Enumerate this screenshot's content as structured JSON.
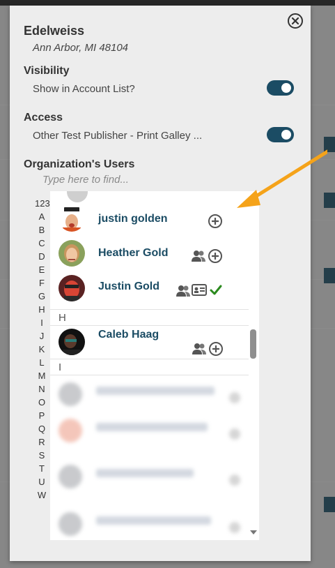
{
  "modal": {
    "org_name": "Edelweiss",
    "org_location": "Ann Arbor, MI 48104",
    "close_icon": "close-circle-icon"
  },
  "visibility": {
    "title": "Visibility",
    "label": "Show in Account List?",
    "enabled": true
  },
  "access": {
    "title": "Access",
    "label": "Other Test Publisher - Print Galley ...",
    "enabled": true
  },
  "users": {
    "title": "Organization's Users",
    "search_placeholder": "Type here to find...",
    "alphabet": [
      "123",
      "A",
      "B",
      "C",
      "D",
      "E",
      "F",
      "G",
      "H",
      "I",
      "J",
      "K",
      "L",
      "M",
      "N",
      "O",
      "P",
      "Q",
      "R",
      "S",
      "T",
      "U",
      "W"
    ],
    "items": [
      {
        "name": "justin golden",
        "icons": [
          "add-circle-icon"
        ]
      },
      {
        "name": "Heather Gold",
        "icons": [
          "users-icon",
          "add-circle-icon"
        ]
      },
      {
        "name": "Justin Gold",
        "icons": [
          "users-icon",
          "id-card-icon",
          "checkmark-icon"
        ]
      }
    ],
    "group_h": "H",
    "items_h": [
      {
        "name": "Caleb Haag",
        "icons": [
          "users-icon",
          "add-circle-icon"
        ]
      }
    ],
    "group_i": "I"
  },
  "colors": {
    "accent": "#1b4c64",
    "check": "#2b8a1e",
    "annotation_arrow": "#f5a31a"
  }
}
